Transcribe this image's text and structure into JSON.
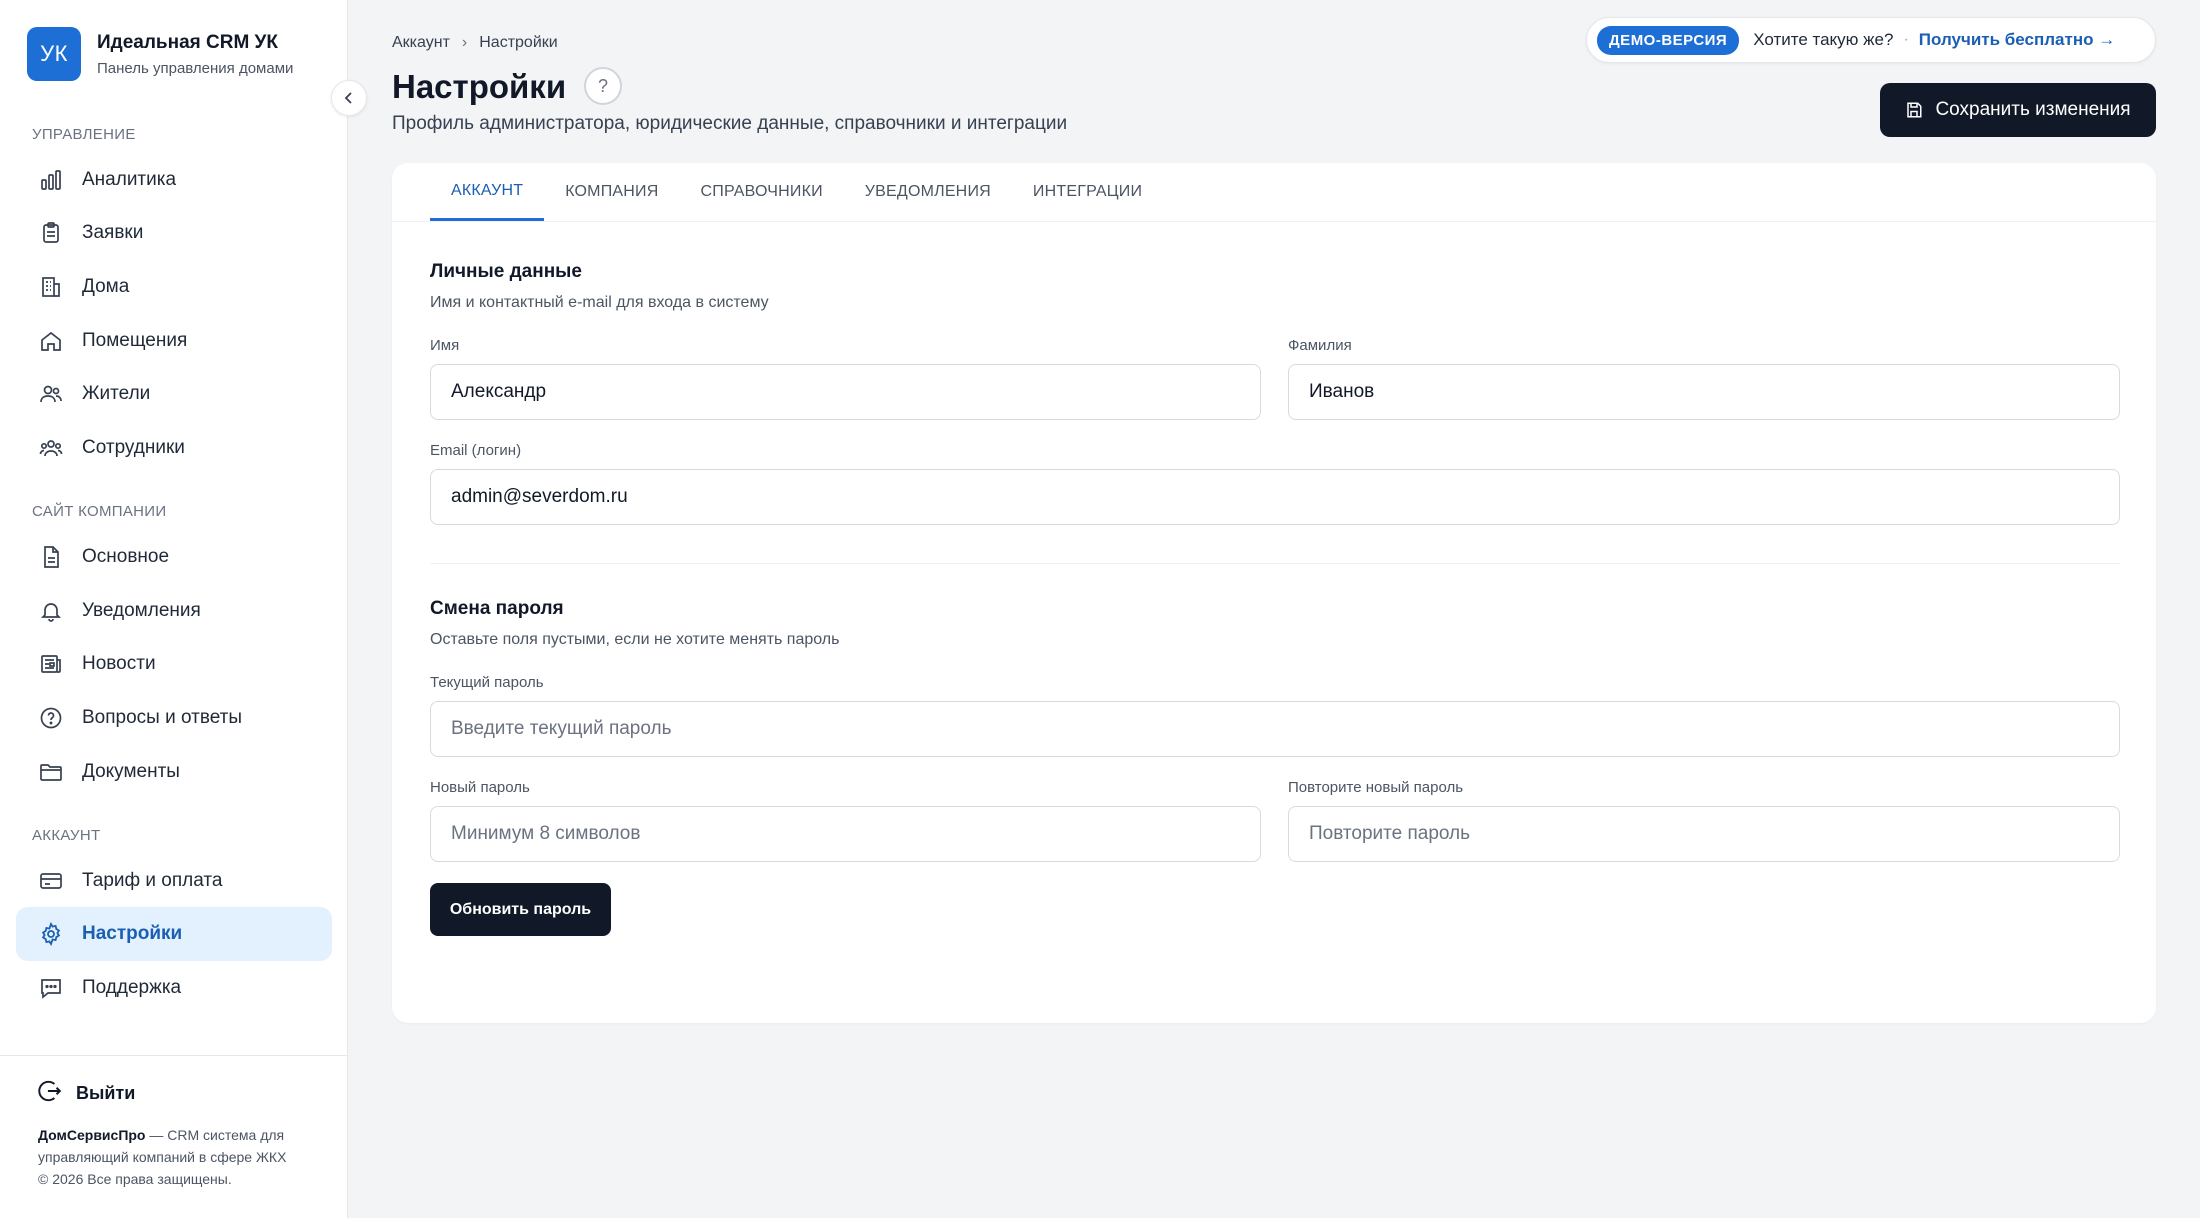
{
  "brand": {
    "logo": "УК",
    "title": "Идеальная CRM УК",
    "subtitle": "Панель управления домами"
  },
  "sidebar": {
    "sections": [
      {
        "label": "Управление"
      },
      {
        "label": "Сайт компании"
      },
      {
        "label": "Аккаунт"
      }
    ],
    "items": [
      {
        "label": "Аналитика",
        "icon": "bar-chart-icon"
      },
      {
        "label": "Заявки",
        "icon": "clipboard-icon"
      },
      {
        "label": "Дома",
        "icon": "building-icon"
      },
      {
        "label": "Помещения",
        "icon": "home-icon"
      },
      {
        "label": "Жители",
        "icon": "users-icon"
      },
      {
        "label": "Сотрудники",
        "icon": "team-icon"
      },
      {
        "label": "Основное",
        "icon": "document-icon"
      },
      {
        "label": "Уведомления",
        "icon": "bell-icon"
      },
      {
        "label": "Новости",
        "icon": "newspaper-icon"
      },
      {
        "label": "Вопросы и ответы",
        "icon": "question-circle-icon"
      },
      {
        "label": "Документы",
        "icon": "folder-icon"
      },
      {
        "label": "Тариф и оплата",
        "icon": "credit-card-icon"
      },
      {
        "label": "Настройки",
        "icon": "gear-icon",
        "active": true
      },
      {
        "label": "Поддержка",
        "icon": "chat-icon"
      }
    ],
    "logout": "Выйти",
    "footer": {
      "brand": "ДомСервисПро",
      "text": " — CRM система для управляющий компаний в сфере ЖКХ",
      "copyright": "© 2026 Все права защищены."
    }
  },
  "header": {
    "breadcrumb": [
      "Аккаунт",
      "Настройки"
    ],
    "breadcrumb_sep": "›",
    "title": "Настройки",
    "help": "?",
    "subtitle": "Профиль администратора, юридические данные, справочники и интеграции",
    "demo": {
      "badge": "ДЕМО-ВЕРСИЯ",
      "question": "Хотите такую же?",
      "dot": "·",
      "link": "Получить бесплатно →"
    },
    "save_label": "Сохранить изменения"
  },
  "tabs": [
    {
      "label": "Аккаунт",
      "active": true
    },
    {
      "label": "Компания"
    },
    {
      "label": "Справочники"
    },
    {
      "label": "Уведомления"
    },
    {
      "label": "Интеграции"
    }
  ],
  "personal": {
    "title": "Личные данные",
    "desc": "Имя и контактный e-mail для входа в систему",
    "first_name_label": "Имя",
    "first_name": "Александр",
    "last_name_label": "Фамилия",
    "last_name": "Иванов",
    "email_label": "Email (логин)",
    "email": "admin@severdom.ru"
  },
  "password": {
    "title": "Смена пароля",
    "desc": "Оставьте поля пустыми, если не хотите менять пароль",
    "current_label": "Текущий пароль",
    "current_placeholder": "Введите текущий пароль",
    "new_label": "Новый пароль",
    "new_placeholder": "Минимум 8 символов",
    "repeat_label": "Повторите новый пароль",
    "repeat_placeholder": "Повторите пароль",
    "update_label": "Обновить пароль"
  },
  "colors": {
    "accent": "#1d6fd6",
    "dark": "#111827",
    "active_bg": "#e3f0fd",
    "page_bg": "#f3f4f6"
  }
}
